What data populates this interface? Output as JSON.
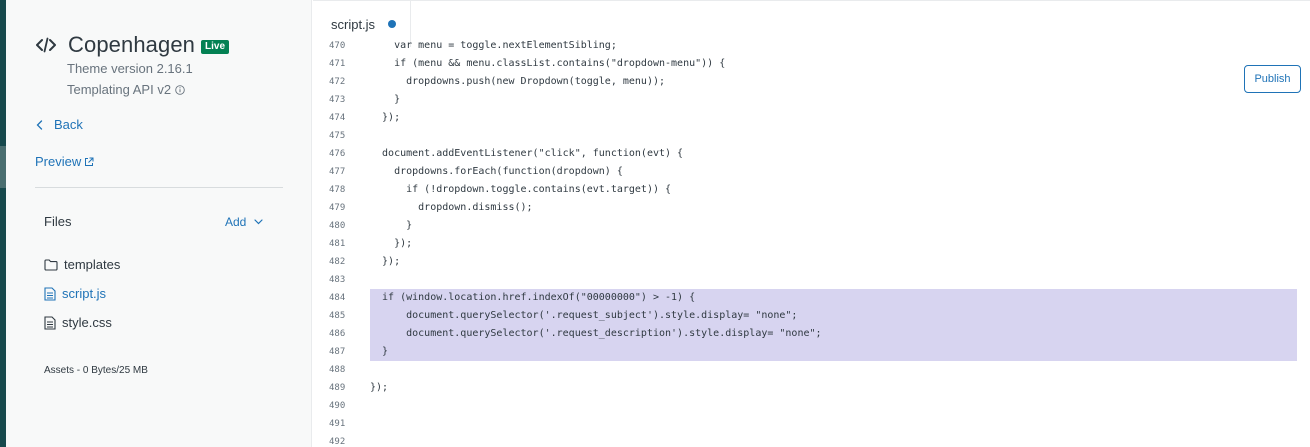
{
  "theme": {
    "name": "Copenhagen",
    "badge": "Live",
    "version": "Theme version 2.16.1",
    "templating": "Templating API v2"
  },
  "nav": {
    "back": "Back",
    "preview": "Preview"
  },
  "files": {
    "title": "Files",
    "add": "Add",
    "items": [
      {
        "name": "templates",
        "icon": "folder-icon"
      },
      {
        "name": "script.js",
        "icon": "file-icon",
        "active": true
      },
      {
        "name": "style.css",
        "icon": "file-icon"
      }
    ],
    "assets": "Assets - 0 Bytes/25 MB"
  },
  "editor": {
    "tab": "script.js",
    "publish": "Publish",
    "lines": [
      {
        "n": "470",
        "t": "    var menu = toggle.nextElementSibling;"
      },
      {
        "n": "471",
        "t": "    if (menu && menu.classList.contains(\"dropdown-menu\")) {"
      },
      {
        "n": "472",
        "t": "      dropdowns.push(new Dropdown(toggle, menu));"
      },
      {
        "n": "473",
        "t": "    }"
      },
      {
        "n": "474",
        "t": "  });"
      },
      {
        "n": "475",
        "t": ""
      },
      {
        "n": "476",
        "t": "  document.addEventListener(\"click\", function(evt) {"
      },
      {
        "n": "477",
        "t": "    dropdowns.forEach(function(dropdown) {"
      },
      {
        "n": "478",
        "t": "      if (!dropdown.toggle.contains(evt.target)) {"
      },
      {
        "n": "479",
        "t": "        dropdown.dismiss();"
      },
      {
        "n": "480",
        "t": "      }"
      },
      {
        "n": "481",
        "t": "    });"
      },
      {
        "n": "482",
        "t": "  });"
      },
      {
        "n": "483",
        "t": ""
      },
      {
        "n": "484",
        "t": "  if (window.location.href.indexOf(\"00000000\") > -1) {",
        "hl": true
      },
      {
        "n": "485",
        "t": "      document.querySelector('.request_subject').style.display= \"none\";",
        "hl": true
      },
      {
        "n": "486",
        "t": "      document.querySelector('.request_description').style.display= \"none\";",
        "hl": true
      },
      {
        "n": "487",
        "t": "  }",
        "hl": true
      },
      {
        "n": "488",
        "t": ""
      },
      {
        "n": "489",
        "t": "});"
      },
      {
        "n": "490",
        "t": ""
      },
      {
        "n": "491",
        "t": ""
      },
      {
        "n": "492",
        "t": ""
      }
    ]
  },
  "colors": {
    "accent": "#1f73b7",
    "live_badge": "#038153",
    "highlight": "#d7d4f0",
    "left_strip": "#17494d"
  }
}
